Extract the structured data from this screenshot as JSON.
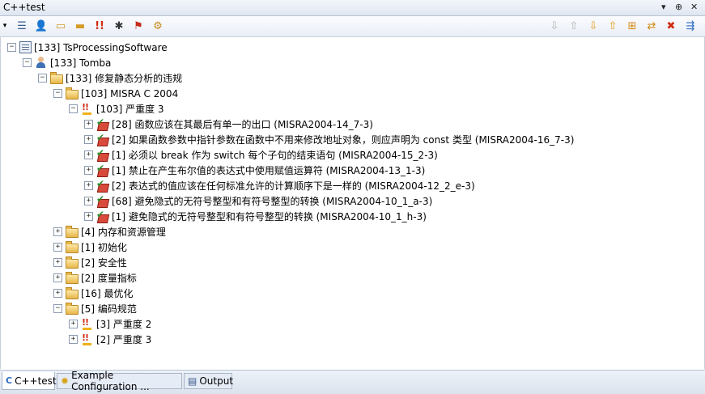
{
  "window": {
    "title": "C++test",
    "pin": "▾  ⊕  ✕"
  },
  "toolbar": {
    "left_icons": [
      "dropdown-icon",
      "list-icon",
      "user-icon",
      "folder-open-icon",
      "folder-icon",
      "severity-icon",
      "bug-icon",
      "flag-icon",
      "settings-icon"
    ],
    "right_icons": [
      "arrow-down-grey-icon",
      "arrow-up-grey-icon",
      "arrow-down-icon",
      "arrow-up-icon",
      "expand-all-icon",
      "sync-icon",
      "delete-icon",
      "navigate-icon"
    ]
  },
  "tree": [
    {
      "label": "[133] TsProcessingSoftware",
      "icon": "project-icon"
    },
    {
      "label": "[133] Tomba",
      "icon": "user-icon"
    },
    {
      "label": "[133] 修复静态分析的违规",
      "icon": "folder-icon"
    },
    {
      "label": "[103] MISRA C 2004",
      "icon": "folder-icon"
    },
    {
      "label": "[103] 严重度 3",
      "icon": "severity-icon"
    },
    {
      "label": "[28] 函数应该在其最后有单一的出口 (MISRA2004-14_7-3)",
      "icon": "rule-icon"
    },
    {
      "label": "[2] 如果函数参数中指针参数在函数中不用来修改地址对象，则应声明为 const 类型 (MISRA2004-16_7-3)",
      "icon": "rule-icon"
    },
    {
      "label": "[1] 必须以 break 作为 switch 每个子句的结束语句 (MISRA2004-15_2-3)",
      "icon": "rule-icon"
    },
    {
      "label": "[1] 禁止在产生布尔值的表达式中使用赋值运算符 (MISRA2004-13_1-3)",
      "icon": "rule-icon"
    },
    {
      "label": "[2] 表达式的值应该在任何标准允许的计算顺序下是一样的 (MISRA2004-12_2_e-3)",
      "icon": "rule-icon"
    },
    {
      "label": "[68] 避免隐式的无符号整型和有符号整型的转换 (MISRA2004-10_1_a-3)",
      "icon": "rule-icon"
    },
    {
      "label": "[1] 避免隐式的无符号整型和有符号整型的转换 (MISRA2004-10_1_h-3)",
      "icon": "rule-icon"
    },
    {
      "label": "[4] 内存和资源管理",
      "icon": "folder-icon"
    },
    {
      "label": "[1] 初始化",
      "icon": "folder-icon"
    },
    {
      "label": "[2] 安全性",
      "icon": "folder-icon"
    },
    {
      "label": "[2] 度量指标",
      "icon": "folder-icon"
    },
    {
      "label": "[16] 最优化",
      "icon": "folder-icon"
    },
    {
      "label": "[5] 编码规范",
      "icon": "folder-icon"
    },
    {
      "label": "[3] 严重度 2",
      "icon": "severity-icon"
    },
    {
      "label": "[2] 严重度 3",
      "icon": "severity-icon"
    }
  ],
  "tabs": [
    {
      "label": "C++test",
      "icon": "cpptest-icon"
    },
    {
      "label": "Example Configuration ...",
      "icon": "configuration-icon"
    },
    {
      "label": "Output",
      "icon": "output-icon"
    }
  ]
}
